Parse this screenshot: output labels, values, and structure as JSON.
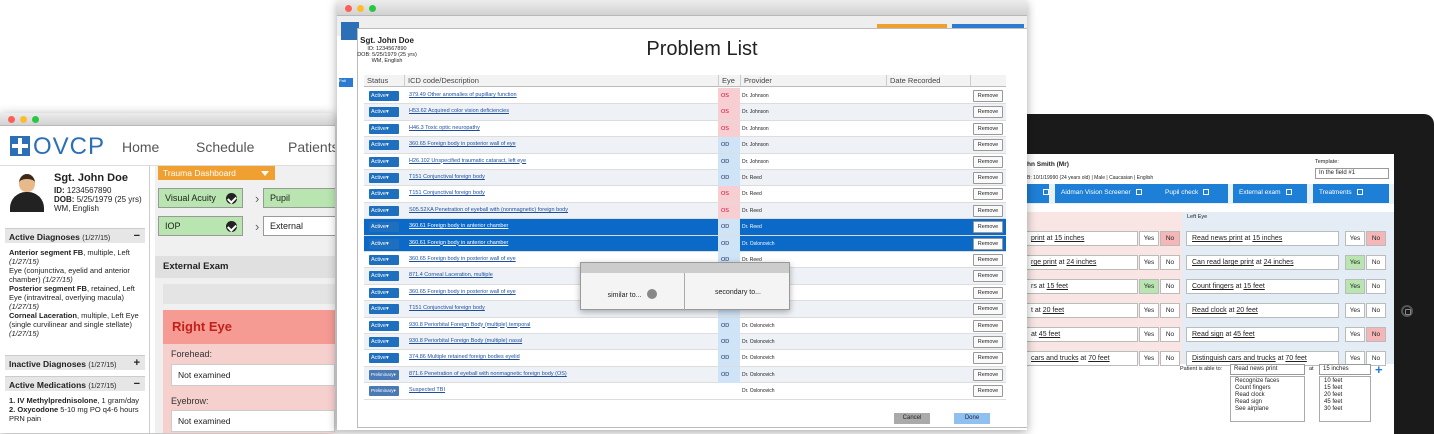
{
  "left_window": {
    "logo": "OVCP",
    "nav": [
      "Home",
      "Schedule",
      "Patients"
    ],
    "patient": {
      "name": "Sgt. John Doe",
      "id_label": "ID:",
      "id": "1234567890",
      "dob_label": "DOB:",
      "dob": "5/25/1979 (25 yrs)",
      "extra": "WM, English"
    },
    "active_diag_title": "Active Diagnoses",
    "active_diag_date": "(1/27/15)",
    "diagnoses": [
      {
        "name": "Anterior segment FB",
        "desc": ", multiple, Left",
        "date": "(1/27/15)"
      },
      {
        "name": "",
        "desc": "Eye (conjunctiva, eyelid and anterior chamber)",
        "date": "(1/27/15)"
      },
      {
        "name": "Posterior segment FB",
        "desc": ", retained, Left Eye (intravitreal, overlying macula)",
        "date": "(1/27/15)"
      },
      {
        "name": "Corneal Laceration",
        "desc": ", multiple, Left Eye (single curvilinear and single stellate)",
        "date": "(1/27/15)"
      }
    ],
    "inactive_diag_title": "Inactive Diagnoses",
    "inactive_diag_date": "(1/27/15)",
    "meds_title": "Active Medications",
    "meds_date": "(1/27/15)",
    "meds": [
      {
        "num": "1.",
        "name": "IV Methylprednisolone",
        "desc": ", 1 gram/day"
      },
      {
        "num": "2.",
        "name": "Oxycodone",
        "desc": " 5-10 mg PO q4-6 hours PRN pain"
      }
    ],
    "trauma_dashboard": "Trauma Dashboard",
    "tiles": [
      "Visual Acuity",
      "Pupil",
      "IOP",
      "External"
    ],
    "external_exam": "External Exam",
    "right_eye": "Right Eye",
    "forehead_label": "Forehead:",
    "forehead_value": "Not examined",
    "eyebrow_label": "Eyebrow:",
    "eyebrow_value": "Not examined"
  },
  "center_window": {
    "patient": {
      "name": "Sgt. John Doe",
      "id": "ID: 1234567890",
      "dob": "DOB: 5/25/1979 (25 yrs)",
      "extra": "WM, English"
    },
    "title": "Problem List",
    "columns": [
      "Status",
      "ICD code/Description",
      "Eye",
      "Provider",
      "Date Recorded"
    ],
    "rows": [
      {
        "status": "Active▾",
        "code": "379.49 Other anomalies of pupillary function",
        "eye": "OS",
        "provider": "Dr. Johnson",
        "remove": "Remove"
      },
      {
        "status": "Active▾",
        "code": "H53.62 Acquired color vision deficiencies",
        "eye": "OS",
        "provider": "Dr. Johnson",
        "remove": "Remove"
      },
      {
        "status": "Active▾",
        "code": "H46.3 Toxic optic neuropathy",
        "eye": "OS",
        "provider": "Dr. Johnson",
        "remove": "Remove"
      },
      {
        "status": "Active▾",
        "code": "360.65 Foreign body in posterior wall of eye",
        "eye": "OD",
        "provider": "Dr. Johnson",
        "remove": "Remove"
      },
      {
        "status": "Active▾",
        "code": "H26.102 Unspecified traumatic cataract, left eye",
        "eye": "OD",
        "provider": "Dr. Johnson",
        "remove": "Remove"
      },
      {
        "status": "Active▾",
        "code": "T151 Conjunctival foreign body",
        "eye": "OD",
        "provider": "Dr. Reed",
        "remove": "Remove"
      },
      {
        "status": "Active▾",
        "code": "T151 Conjunctival foreign body",
        "eye": "OS",
        "provider": "Dr. Reed",
        "remove": "Remove"
      },
      {
        "status": "Active▾",
        "code": "S05.52XA Penetration of eyeball with (nonmagnetic) foreign body",
        "eye": "OS",
        "provider": "Dr. Reed",
        "remove": "Remove"
      },
      {
        "status": "Active▾",
        "code": "360.61 Foreign body in anterior chamber",
        "eye": "OD",
        "provider": "Dr. Reed",
        "remove": "Remove"
      },
      {
        "status": "Active▾",
        "code": "360.61 Foreign body in anterior chamber",
        "eye": "OD",
        "provider": "Dr. Oslonovich",
        "remove": "Remove"
      },
      {
        "status": "Active▾",
        "code": "360.65 Foreign body in posterior wall of eye",
        "eye": "OD",
        "provider": "Dr. Reed",
        "remove": "Remove"
      },
      {
        "status": "Active▾",
        "code": "871.4 Corneal Laceration, multiple",
        "eye": "",
        "provider": "",
        "remove": "Remove"
      },
      {
        "status": "Active▾",
        "code": "360.65 Foreign body in posterior wall of eye",
        "eye": "",
        "provider": "",
        "remove": "Remove"
      },
      {
        "status": "Active▾",
        "code": "T151 Conjunctival foreign body",
        "eye": "OD",
        "provider": "Dr. Oslonovich",
        "remove": "Remove"
      },
      {
        "status": "Active▾",
        "code": "930.8 Periorbital Foreign Body (multiple) temporal",
        "eye": "OD",
        "provider": "Dr. Oslonovich",
        "remove": "Remove"
      },
      {
        "status": "Active▾",
        "code": "930.8 Periorbital Foreign Body (multiple) nasal",
        "eye": "OD",
        "provider": "Dr. Oslonovich",
        "remove": "Remove"
      },
      {
        "status": "Active▾",
        "code": "374.86 Multiple retained foreign bodies eyelid",
        "eye": "OD",
        "provider": "Dr. Oslonovich",
        "remove": "Remove"
      },
      {
        "status": "Preliminary▾",
        "code": "871.6 Penetration of eyeball with nonmagnetic foreign body (OS)",
        "eye": "OD",
        "provider": "Dr. Oslonovich",
        "remove": "Remove"
      },
      {
        "status": "Preliminary▾",
        "code": "Suspected TBI",
        "eye": "",
        "provider": "Dr. Oslonovich",
        "remove": "Remove"
      }
    ],
    "dialog": {
      "similar": "similar to...",
      "secondary": "secondary to..."
    },
    "cancel": "Cancel",
    "done": "Done"
  },
  "right_window": {
    "patient": "hn Smith (Mr)",
    "patient_info": "B: 10/1/19990 (24 years old) | Male | Caucasian | English",
    "template_label": "Template:",
    "template_value": "In the field #1",
    "tabs": [
      "Aidman Vision Screener",
      "Pupil check",
      "External exam",
      "Treatments"
    ],
    "left_eye": "Left Eye",
    "right_rows": [
      {
        "pre": "",
        "u1": "print",
        "mid": " at ",
        "u2": "15 inches"
      },
      {
        "pre": "",
        "u1": "rge print",
        "mid": " at ",
        "u2": "24 inches"
      },
      {
        "pre": "rs at ",
        "u1": "",
        "mid": "",
        "u2": "15 feet"
      },
      {
        "pre": "t at ",
        "u1": "",
        "mid": "",
        "u2": "20 feet"
      },
      {
        "pre": "at ",
        "u1": "",
        "mid": "",
        "u2": "45 feet"
      },
      {
        "pre": "",
        "u1": "cars and trucks",
        "mid": " at ",
        "u2": "70 feet"
      }
    ],
    "left_rows": [
      {
        "u1": "Read news print",
        "mid": " at ",
        "u2": "15 inches"
      },
      {
        "u1": "Can read large print",
        "mid": " at ",
        "u2": "24 inches"
      },
      {
        "u1": "Count fingers",
        "mid": " at ",
        "u2": "15 feet"
      },
      {
        "u1": "Read clock",
        "mid": " at ",
        "u2": "20 feet"
      },
      {
        "u1": "Read sign",
        "mid": " at ",
        "u2": "45 feet"
      },
      {
        "u1": "Distinguish cars and trucks",
        "mid": " at ",
        "u2": "70 feet"
      }
    ],
    "yes": "Yes",
    "no": "No",
    "able_label": "Patient is able to:",
    "able_value": "Read news print",
    "at": "at",
    "dist_value": "15 inches",
    "able_options": [
      "Recognize faces",
      "Count fingers",
      "Read clock",
      "Read sign",
      "See airplane"
    ],
    "dist_options": [
      "10 feet",
      "15 feet",
      "20 feet",
      "45 feet",
      "30 feet"
    ]
  }
}
